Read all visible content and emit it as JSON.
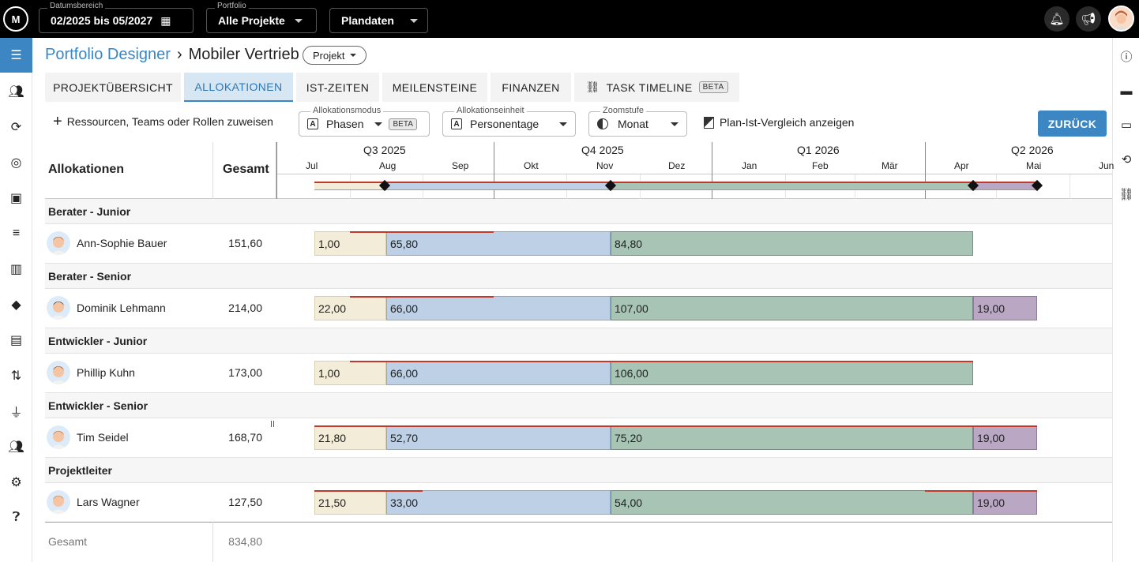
{
  "topbar": {
    "date_label": "Datumsbereich",
    "date_value": "02/2025 bis 05/2027",
    "portfolio_label": "Portfolio",
    "portfolio_value": "Alle Projekte",
    "data_value": "Plandaten"
  },
  "header": {
    "breadcrumb_link": "Portfolio Designer",
    "breadcrumb_sep": "›",
    "title": "Mobiler Vertrieb",
    "type_chip": "Projekt"
  },
  "tabs": [
    {
      "label": "Projektübersicht"
    },
    {
      "label": "Allokationen"
    },
    {
      "label": "IST-Zeiten"
    },
    {
      "label": "Meilensteine"
    },
    {
      "label": "Finanzen"
    },
    {
      "label": "Task Timeline",
      "badge": "BETA"
    }
  ],
  "toolbar": {
    "assign_label": "Ressourcen, Teams oder Rollen zuweisen",
    "mode_label": "Allokationsmodus",
    "mode_value": "Phasen",
    "mode_badge": "BETA",
    "unit_label": "Allokationseinheit",
    "unit_value": "Personentage",
    "zoom_label": "Zoomstufe",
    "zoom_value": "Monat",
    "compare_label": "Plan-Ist-Vergleich anzeigen",
    "back_label": "ZURÜCK"
  },
  "grid": {
    "col_allocations": "Allokationen",
    "col_total": "Gesamt",
    "quarters": [
      "Q3 2025",
      "Q4 2025",
      "Q1 2026",
      "Q2 2026"
    ],
    "months": [
      "Jul",
      "Aug",
      "Sep",
      "Okt",
      "Nov",
      "Dez",
      "Jan",
      "Feb",
      "Mär",
      "Apr",
      "Mai",
      "Jun"
    ],
    "groups": [
      {
        "label": "Berater - Junior",
        "person": "Ann-Sophie Bauer",
        "total": "151,60",
        "phases": [
          "1,00",
          "65,80",
          "84,80",
          ""
        ]
      },
      {
        "label": "Berater - Senior",
        "person": "Dominik Lehmann",
        "total": "214,00",
        "phases": [
          "22,00",
          "66,00",
          "107,00",
          "19,00"
        ]
      },
      {
        "label": "Entwickler - Junior",
        "person": "Phillip Kuhn",
        "total": "173,00",
        "phases": [
          "1,00",
          "66,00",
          "106,00",
          ""
        ]
      },
      {
        "label": "Entwickler - Senior",
        "person": "Tim Seidel",
        "total": "168,70",
        "phases": [
          "21,80",
          "52,70",
          "75,20",
          "19,00"
        ]
      },
      {
        "label": "Projektleiter",
        "person": "Lars Wagner",
        "total": "127,50",
        "phases": [
          "21,50",
          "33,00",
          "54,00",
          "19,00"
        ]
      }
    ],
    "total_label": "Gesamt",
    "total_value": "834,80"
  },
  "colors": {
    "accent": "#3c86c4",
    "phase1": "#f3ecd8",
    "phase2": "#bdd0e5",
    "phase3": "#a7c4b5",
    "phase4": "#b9a7c4"
  }
}
